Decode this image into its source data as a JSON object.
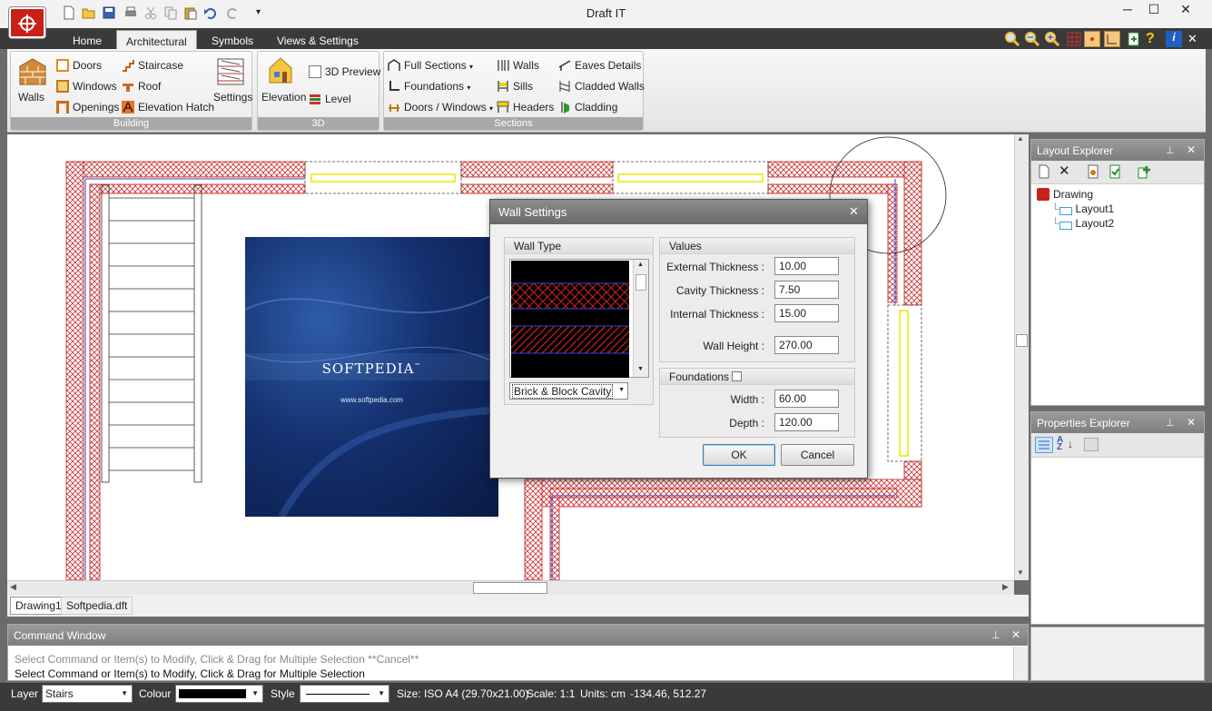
{
  "app": {
    "title": "Draft IT"
  },
  "window_controls": {
    "minimize": "─",
    "maximize": "☐",
    "close": "✕"
  },
  "quick_access": [
    "new-icon",
    "open-icon",
    "save-icon",
    "print-icon",
    "cut-icon",
    "copy-icon",
    "paste-icon",
    "undo-icon",
    "redo-icon",
    "customize-icon"
  ],
  "tabs": [
    "Home",
    "Architectural",
    "Symbols",
    "Views & Settings"
  ],
  "active_tab": "Architectural",
  "ribbon": {
    "building": {
      "label": "Building",
      "walls": "Walls",
      "doors": "Doors",
      "windows": "Windows",
      "openings": "Openings",
      "staircase": "Staircase",
      "roof": "Roof",
      "elevation_hatch": "Elevation Hatch",
      "settings": "Settings"
    },
    "three_d": {
      "label": "3D",
      "elevation": "Elevation",
      "preview": "3D Preview",
      "level": "Level"
    },
    "sections": {
      "label": "Sections",
      "full_sections": "Full Sections",
      "foundations": "Foundations",
      "doors_windows": "Doors / Windows",
      "walls": "Walls",
      "sills": "Sills",
      "headers": "Headers",
      "eaves_details": "Eaves Details",
      "cladded_walls": "Cladded Walls",
      "cladding": "Cladding"
    }
  },
  "dialog": {
    "title": "Wall Settings",
    "close": "✕",
    "wall_type_legend": "Wall Type",
    "wall_type_selected": "Brick & Block Cavity",
    "values_legend": "Values",
    "external_thickness_label": "External Thickness :",
    "external_thickness": "10.00",
    "cavity_thickness_label": "Cavity Thickness :",
    "cavity_thickness": "7.50",
    "internal_thickness_label": "Internal Thickness :",
    "internal_thickness": "15.00",
    "wall_height_label": "Wall Height :",
    "wall_height": "270.00",
    "foundations_legend": "Foundations",
    "width_label": "Width :",
    "width": "60.00",
    "depth_label": "Depth :",
    "depth": "120.00",
    "ok": "OK",
    "cancel": "Cancel"
  },
  "splash": {
    "brand": "SOFTPEDIA",
    "tm": "™",
    "url": "www.softpedia.com"
  },
  "doc_tabs": [
    "Drawing1",
    "Softpedia.dft"
  ],
  "command_window": {
    "title": "Command Window",
    "line1": "Select Command or Item(s) to Modify, Click & Drag for Multiple Selection  **Cancel**",
    "line2": "Select Command or Item(s) to Modify, Click & Drag for Multiple Selection"
  },
  "layout_explorer": {
    "title": "Layout Explorer",
    "root": "Drawing",
    "children": [
      "Layout1",
      "Layout2"
    ]
  },
  "properties_explorer": {
    "title": "Properties Explorer"
  },
  "status": {
    "layer_label": "Layer",
    "layer_value": "Stairs",
    "colour_label": "Colour",
    "style_label": "Style",
    "size": "Size: ISO A4 (29.70x21.00)",
    "scale": "Scale: 1:1",
    "units": "Units: cm",
    "coords": "-134.46, 512.27"
  },
  "colors": {
    "accent": "#c8201a",
    "dark_bar": "#3a3a3a",
    "hatch": "#cc3333",
    "window_line": "#e8e800"
  }
}
